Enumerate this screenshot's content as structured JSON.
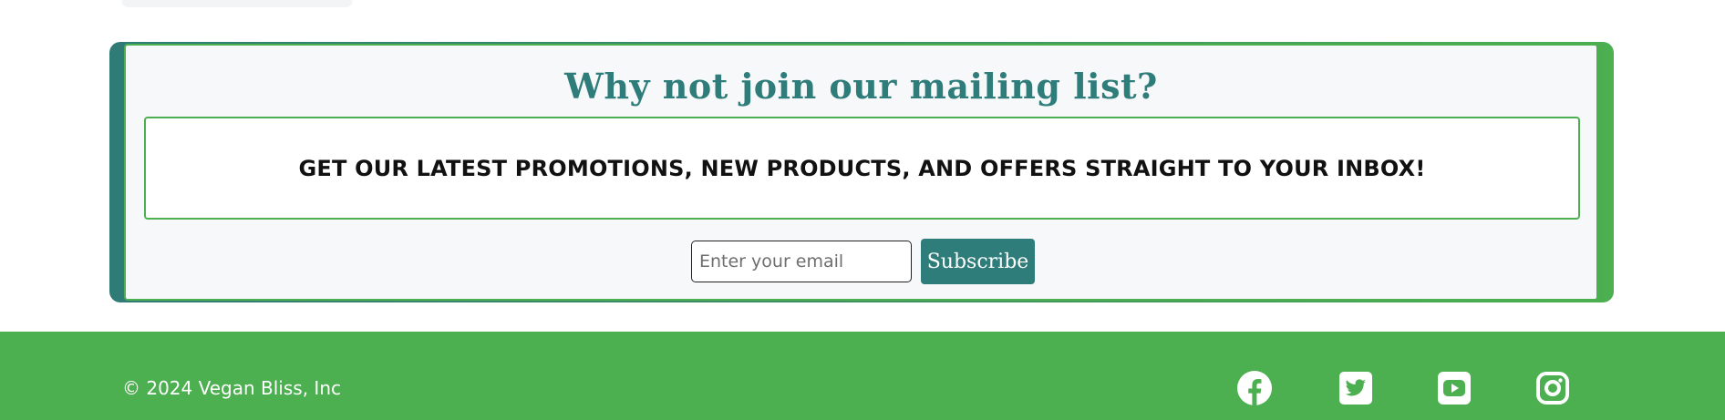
{
  "mailing": {
    "title": "Why not join our mailing list?",
    "promo": "GET OUR LATEST PROMOTIONS, NEW PRODUCTS, AND OFFERS STRAIGHT TO YOUR INBOX!",
    "email_placeholder": "Enter your email",
    "email_value": "",
    "subscribe_label": "Subscribe"
  },
  "footer": {
    "copyright": "© 2024 Vegan Bliss, Inc",
    "social": [
      {
        "icon": "facebook-icon"
      },
      {
        "icon": "twitter-icon"
      },
      {
        "icon": "youtube-icon"
      },
      {
        "icon": "instagram-icon"
      }
    ]
  },
  "colors": {
    "brand_green": "#4caf50",
    "brand_teal": "#2e7d7a",
    "panel_bg": "#f7f8f9"
  }
}
